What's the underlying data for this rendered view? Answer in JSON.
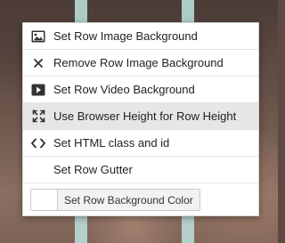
{
  "background": {
    "stripe_color": "#b9dcd6"
  },
  "menu": {
    "items": [
      {
        "label": "Set Row Image Background",
        "icon": "image-icon"
      },
      {
        "label": "Remove Row Image Background",
        "icon": "close-icon"
      },
      {
        "label": "Set Row Video Background",
        "icon": "video-play-icon"
      },
      {
        "label": "Use Browser Height for Row Height",
        "icon": "expand-icon",
        "highlighted": true
      },
      {
        "label": "Set HTML class and id",
        "icon": "code-icon"
      },
      {
        "label": "Set Row Gutter"
      }
    ],
    "color_button": {
      "label": "Set Row Background Color",
      "swatch_color": "#ffffff"
    }
  }
}
